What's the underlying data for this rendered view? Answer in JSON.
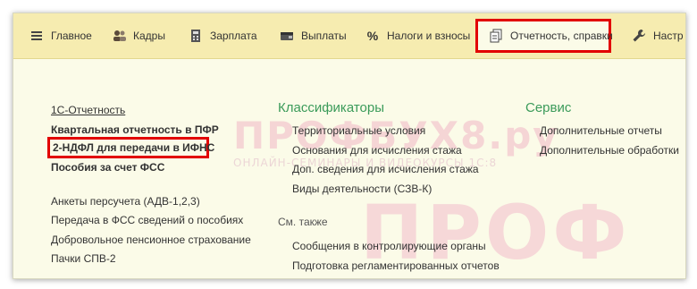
{
  "toolbar": {
    "tabs": [
      {
        "label": "Главное",
        "icon": "menu-icon"
      },
      {
        "label": "Кадры",
        "icon": "people-icon"
      },
      {
        "label": "Зарплата",
        "icon": "calculator-icon"
      },
      {
        "label": "Выплаты",
        "icon": "wallet-icon"
      },
      {
        "label": "Налоги и взносы",
        "icon": "percent-icon"
      },
      {
        "label": "Отчетность, справки",
        "icon": "documents-icon"
      },
      {
        "label": "Настр",
        "icon": "wrench-icon"
      }
    ],
    "active_tab": "Отчетность, справки"
  },
  "watermark": {
    "brand": "ПРОФБУХ8.ру",
    "subtitle": "ОНЛАЙН-СЕМИНАРЫ И ВИДЕОКУРСЫ 1С:8",
    "large": "ПРОФ"
  },
  "reports": {
    "items": [
      "1С-Отчетность",
      "Квартальная отчетность в ПФР",
      "2-НДФЛ для передачи в ИФНС",
      "Пособия за счет ФСС",
      "Анкеты персучета (АДВ-1,2,3)",
      "Передача в ФСС сведений о пособиях",
      "Добровольное пенсионное страхование",
      "Пачки СПВ-2"
    ]
  },
  "classifiers": {
    "title": "Классификаторы",
    "items": [
      "Территориальные условия",
      "Основания для исчисления стажа",
      "Доп. сведения для исчисления стажа",
      "Виды деятельности (СЗВ-К)"
    ],
    "see_also_title": "См. также",
    "see_also": [
      "Сообщения в контролирующие органы",
      "Подготовка регламентированных отчетов"
    ]
  },
  "service": {
    "title": "Сервис",
    "items": [
      "Дополнительные отчеты",
      "Дополнительные обработки"
    ]
  },
  "colors": {
    "toolbar_bg": "#f6ecb0",
    "content_bg": "#fbfbe8",
    "highlight_red": "#e20000",
    "section_green": "#3b9b5a"
  }
}
